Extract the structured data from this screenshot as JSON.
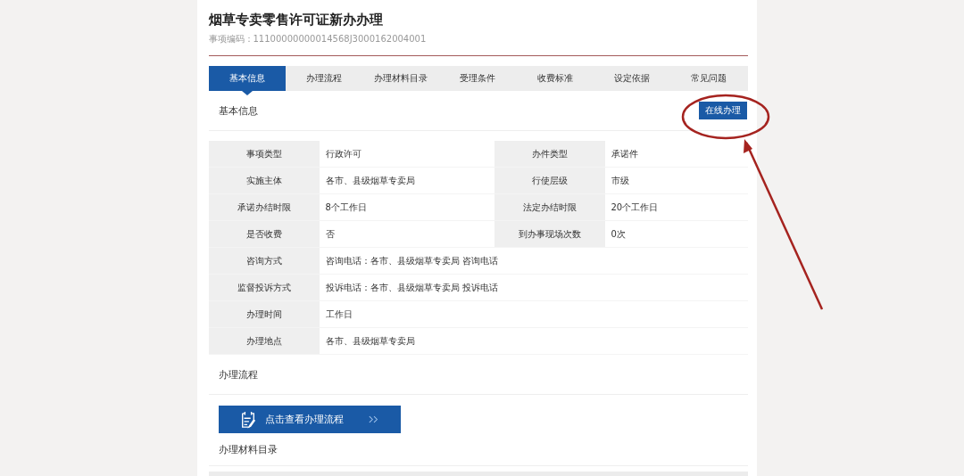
{
  "page": {
    "title": "烟草专卖零售许可证新办办理",
    "code": "事项编码：11100000000014568J3000162004001"
  },
  "tabs": [
    {
      "label": "基本信息",
      "selected": true
    },
    {
      "label": "办理流程",
      "selected": false
    },
    {
      "label": "办理材料目录",
      "selected": false
    },
    {
      "label": "受理条件",
      "selected": false
    },
    {
      "label": "收费标准",
      "selected": false
    },
    {
      "label": "设定依据",
      "selected": false
    },
    {
      "label": "常见问题",
      "selected": false
    }
  ],
  "basic_info": {
    "heading": "基本信息",
    "online_button": "在线办理",
    "rows": [
      [
        {
          "label": "事项类型",
          "value": "行政许可"
        },
        {
          "label": "办件类型",
          "value": "承诺件"
        }
      ],
      [
        {
          "label": "实施主体",
          "value": "各市、县级烟草专卖局"
        },
        {
          "label": "行使层级",
          "value": "市级"
        }
      ],
      [
        {
          "label": "承诺办结时限",
          "value": "8个工作日"
        },
        {
          "label": "法定办结时限",
          "value": "20个工作日"
        }
      ],
      [
        {
          "label": "是否收费",
          "value": "否"
        },
        {
          "label": "到办事现场次数",
          "value": "0次"
        }
      ],
      [
        {
          "label": "咨询方式",
          "value": "咨询电话：各市、县级烟草专卖局 咨询电话"
        }
      ],
      [
        {
          "label": "监督投诉方式",
          "value": "投诉电话：各市、县级烟草专卖局 投诉电话"
        }
      ],
      [
        {
          "label": "办理时间",
          "value": "工作日"
        }
      ],
      [
        {
          "label": "办理地点",
          "value": "各市、县级烟草专卖局"
        }
      ]
    ]
  },
  "process": {
    "heading": "办理流程",
    "button": "点击查看办理流程"
  },
  "materials": {
    "heading": "办理材料目录"
  }
}
